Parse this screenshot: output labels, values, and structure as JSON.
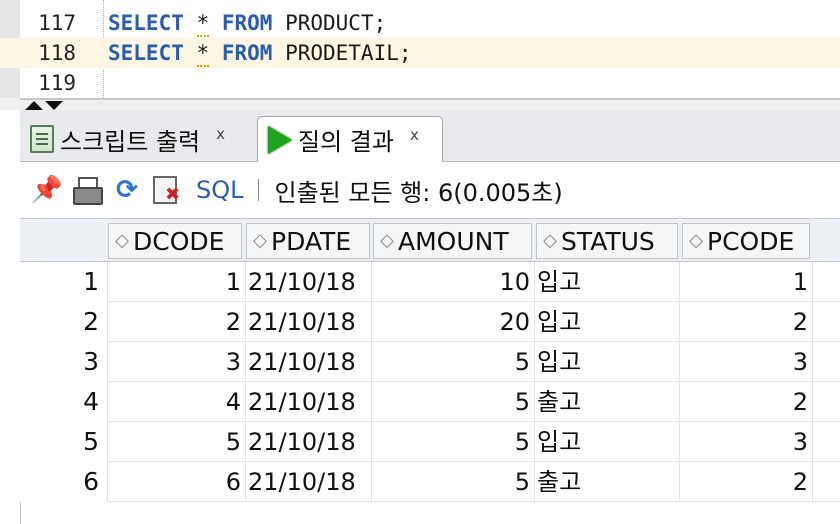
{
  "editor": {
    "lines": [
      {
        "num": "117",
        "select": "SELECT",
        "star": "*",
        "from": "FROM",
        "rest": "PRODUCT;"
      },
      {
        "num": "118",
        "select": "SELECT",
        "star": "*",
        "from": "FROM",
        "rest": "PRODETAIL;"
      },
      {
        "num": "119"
      }
    ]
  },
  "tabs": {
    "script_output": {
      "label": "스크립트 출력",
      "close": "x"
    },
    "query_result": {
      "label": "질의 결과",
      "close": "x"
    }
  },
  "toolbar": {
    "sql_label": "SQL",
    "status": "인출된 모든 행: 6(0.005초)"
  },
  "grid": {
    "columns": [
      "DCODE",
      "PDATE",
      "AMOUNT",
      "STATUS",
      "PCODE"
    ],
    "rows": [
      {
        "n": "1",
        "dcode": "1",
        "pdate": "21/10/18",
        "amount": "10",
        "status": "입고",
        "pcode": "1"
      },
      {
        "n": "2",
        "dcode": "2",
        "pdate": "21/10/18",
        "amount": "20",
        "status": "입고",
        "pcode": "2"
      },
      {
        "n": "3",
        "dcode": "3",
        "pdate": "21/10/18",
        "amount": "5",
        "status": "입고",
        "pcode": "3"
      },
      {
        "n": "4",
        "dcode": "4",
        "pdate": "21/10/18",
        "amount": "5",
        "status": "출고",
        "pcode": "2"
      },
      {
        "n": "5",
        "dcode": "5",
        "pdate": "21/10/18",
        "amount": "5",
        "status": "입고",
        "pcode": "3"
      },
      {
        "n": "6",
        "dcode": "6",
        "pdate": "21/10/18",
        "amount": "5",
        "status": "출고",
        "pcode": "2"
      }
    ]
  }
}
